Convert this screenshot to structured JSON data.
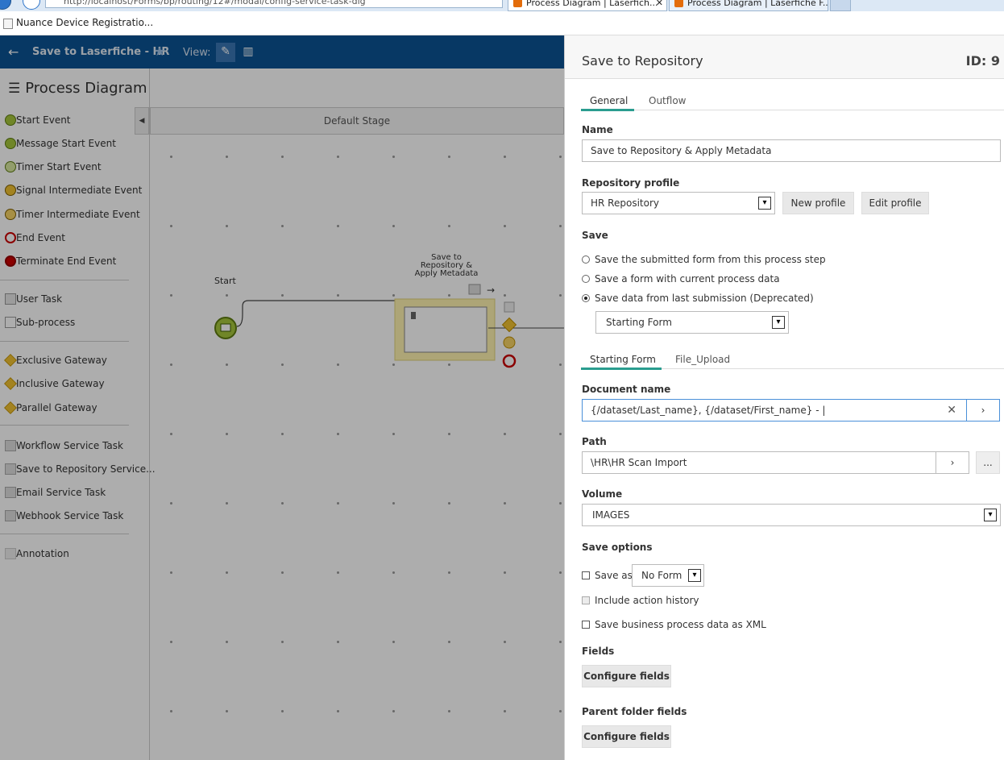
{
  "browser": {
    "address": "http://localhost/Forms/bp/routing/12#/modal/config-service-task-dlg",
    "tabs": [
      {
        "label": "Process Diagram | Laserfich..."
      },
      {
        "label": "Process Diagram | Laserfiche F..."
      }
    ],
    "bookmark": "Nuance Device Registratio..."
  },
  "header": {
    "title": "Save to Laserfiche - HR",
    "view_label": "View:"
  },
  "palette": {
    "title": "Process Diagram",
    "items": [
      {
        "label": "Start Event"
      },
      {
        "label": "Message Start Event"
      },
      {
        "label": "Timer Start Event"
      },
      {
        "label": "Signal Intermediate Event"
      },
      {
        "label": "Timer Intermediate Event"
      },
      {
        "label": "End Event"
      },
      {
        "label": "Terminate End Event"
      },
      {
        "label": "User Task"
      },
      {
        "label": "Sub-process"
      },
      {
        "label": "Exclusive Gateway"
      },
      {
        "label": "Inclusive Gateway"
      },
      {
        "label": "Parallel Gateway"
      },
      {
        "label": "Workflow Service Task"
      },
      {
        "label": "Save to Repository Service..."
      },
      {
        "label": "Email Service Task"
      },
      {
        "label": "Webhook Service Task"
      },
      {
        "label": "Annotation"
      }
    ]
  },
  "canvas": {
    "stage": "Default Stage",
    "start_label": "Start",
    "task_label": "Save to Repository & Apply Metadata"
  },
  "panel": {
    "title": "Save to Repository",
    "id": "ID: 9",
    "tabs": [
      {
        "label": "General"
      },
      {
        "label": "Outflow"
      }
    ],
    "name_label": "Name",
    "name_value": "Save to Repository & Apply Metadata",
    "repo_label": "Repository profile",
    "repo_value": "HR Repository",
    "new_profile": "New profile",
    "edit_profile": "Edit profile",
    "save_label": "Save",
    "save_options": [
      {
        "label": "Save the submitted form from this process step",
        "checked": false
      },
      {
        "label": "Save a form with current process data",
        "checked": false
      },
      {
        "label": "Save data from last submission (Deprecated)",
        "checked": true
      }
    ],
    "submission_value": "Starting Form",
    "form_tabs": [
      {
        "label": "Starting Form"
      },
      {
        "label": "File_Upload"
      }
    ],
    "doc_name_label": "Document name",
    "doc_name_value": "{/dataset/Last_name}, {/dataset/First_name} - |",
    "path_label": "Path",
    "path_value": "\\HR\\HR Scan Import",
    "browse_label": "...",
    "volume_label": "Volume",
    "volume_value": "IMAGES",
    "save_options_label": "Save options",
    "save_as_label": "Save as",
    "save_as_value": "No Form",
    "include_history": "Include action history",
    "save_xml": "Save business process data as XML",
    "fields_label": "Fields",
    "configure_fields": "Configure fields",
    "parent_fields_label": "Parent folder fields",
    "configure_parent_fields": "Configure fields"
  }
}
